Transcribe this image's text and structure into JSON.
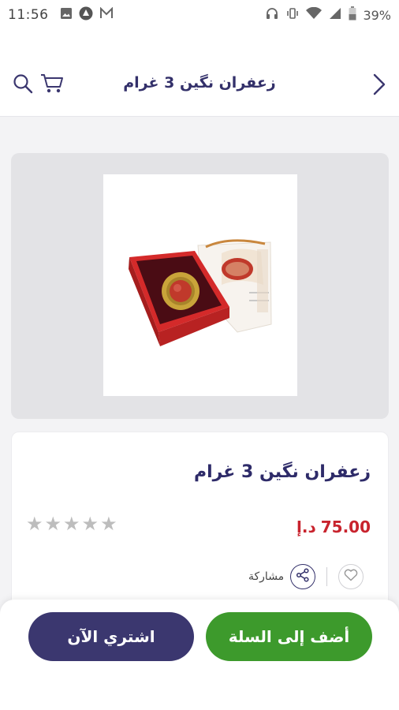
{
  "status_bar": {
    "time": "11:56",
    "battery": "39%",
    "icons": [
      "image-icon",
      "notification-icon",
      "mail-icon",
      "headset-icon",
      "vibrate-icon",
      "wifi-icon",
      "signal-icon",
      "battery-icon"
    ]
  },
  "header": {
    "title": "زعفران نگين 3 غرام",
    "icons": [
      "search-icon",
      "cart-icon",
      "chevron-right-icon"
    ]
  },
  "product": {
    "name": "زعفران نگين 3 غرام",
    "price": "75.00",
    "currency": "د.إ",
    "rating": 0,
    "rating_max": 5,
    "share_label": "مشاركة"
  },
  "buttons": {
    "buy_now": "اشتري الآن",
    "add_to_cart": "أضف إلى السلة"
  },
  "colors": {
    "brand_navy": "#33306a",
    "add_green": "#3d9a2c",
    "buy_navy": "#3b376f",
    "price_red": "#c8232d"
  }
}
